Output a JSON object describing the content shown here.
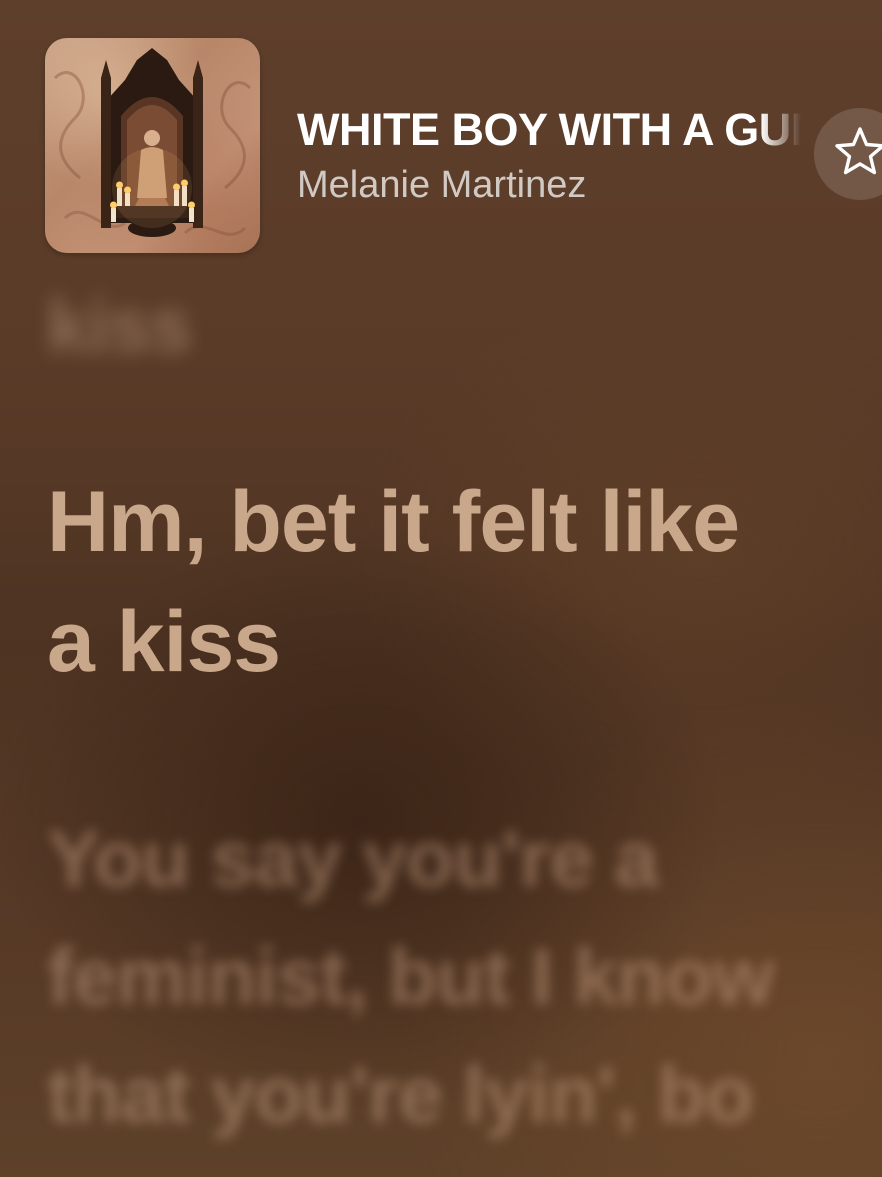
{
  "now_playing": {
    "title": "WHITE BOY WITH A GUN",
    "artist": "Melanie Martinez",
    "favorite_icon": "star-outline-icon",
    "album_art": "album-art"
  },
  "lyrics": {
    "previous": "kiss",
    "current_lines": [
      "Hm, bet it felt like",
      "a kiss"
    ],
    "upcoming_lines": [
      "You say you're a",
      "feminist, but I know",
      "that you're lyin', bo"
    ]
  },
  "colors": {
    "background": "#573a26",
    "current_lyric": "#c9a78b",
    "title": "#ffffff"
  }
}
